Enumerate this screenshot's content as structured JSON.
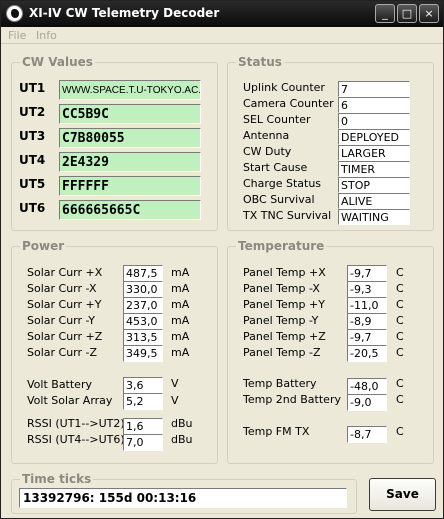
{
  "window": {
    "title": "XI-IV CW Telemetry Decoder",
    "minimize_glyph": "_",
    "maximize_glyph": "□",
    "close_glyph": "×"
  },
  "menu": {
    "file": "File",
    "info": "Info"
  },
  "cw_values": {
    "title": "CW Values",
    "rows": [
      {
        "label": "UT1",
        "value": "WWW.SPACE.T.U-TOKYO.AC.JP"
      },
      {
        "label": "UT2",
        "value": "CC5B9C"
      },
      {
        "label": "UT3",
        "value": "C7B80055"
      },
      {
        "label": "UT4",
        "value": "2E4329"
      },
      {
        "label": "UT5",
        "value": "FFFFFF"
      },
      {
        "label": "UT6",
        "value": "666665665C"
      }
    ]
  },
  "status": {
    "title": "Status",
    "rows": [
      {
        "label": "Uplink Counter",
        "value": "7"
      },
      {
        "label": "Camera Counter",
        "value": "6"
      },
      {
        "label": "SEL Counter",
        "value": "0"
      },
      {
        "label": "Antenna",
        "value": "DEPLOYED"
      },
      {
        "label": "CW Duty",
        "value": "LARGER"
      },
      {
        "label": "Start Cause",
        "value": "TIMER"
      },
      {
        "label": "Charge Status",
        "value": "STOP"
      },
      {
        "label": "OBC Survival",
        "value": "ALIVE"
      },
      {
        "label": "TX TNC Survival",
        "value": "WAITING"
      }
    ]
  },
  "power": {
    "title": "Power",
    "currents": [
      {
        "label": "Solar Curr +X",
        "value": "487,5",
        "unit": "mA"
      },
      {
        "label": "Solar Curr -X",
        "value": "330,0",
        "unit": "mA"
      },
      {
        "label": "Solar Curr +Y",
        "value": "237,0",
        "unit": "mA"
      },
      {
        "label": "Solar Curr -Y",
        "value": "453,0",
        "unit": "mA"
      },
      {
        "label": "Solar Curr +Z",
        "value": "313,5",
        "unit": "mA"
      },
      {
        "label": "Solar Curr -Z",
        "value": "349,5",
        "unit": "mA"
      }
    ],
    "voltages": [
      {
        "label": "Volt Battery",
        "value": "3,6",
        "unit": "V"
      },
      {
        "label": "Volt Solar Array",
        "value": "5,2",
        "unit": "V"
      }
    ],
    "rssi": [
      {
        "label": "RSSI (UT1-->UT2)",
        "value": "1,6",
        "unit": "dBu"
      },
      {
        "label": "RSSI (UT4-->UT6)",
        "value": "7,0",
        "unit": "dBu"
      }
    ]
  },
  "temperature": {
    "title": "Temperature",
    "panels": [
      {
        "label": "Panel Temp +X",
        "value": "-9,7",
        "unit": "C"
      },
      {
        "label": "Panel Temp -X",
        "value": "-9,3",
        "unit": "C"
      },
      {
        "label": "Panel Temp +Y",
        "value": "-11,0",
        "unit": "C"
      },
      {
        "label": "Panel Temp -Y",
        "value": "-8,9",
        "unit": "C"
      },
      {
        "label": "Panel Temp +Z",
        "value": "-9,7",
        "unit": "C"
      },
      {
        "label": "Panel Temp -Z",
        "value": "-20,5",
        "unit": "C"
      }
    ],
    "battery": [
      {
        "label": "Temp Battery",
        "value": "-48,0",
        "unit": "C"
      },
      {
        "label": "Temp 2nd Battery",
        "value": "-9,0",
        "unit": "C"
      }
    ],
    "fm_tx": {
      "label": "Temp FM TX",
      "value": "-8,7",
      "unit": "C"
    }
  },
  "time_ticks": {
    "title": "Time ticks",
    "value": "13392796:  155d 00:13:16"
  },
  "save_label": "Save",
  "colors": {
    "cw_field_bg": "#c0f0c0",
    "window_bg": "#ece9d8",
    "titlebar": "#111111"
  },
  "icons": {
    "app": "satellite-logo-icon"
  }
}
